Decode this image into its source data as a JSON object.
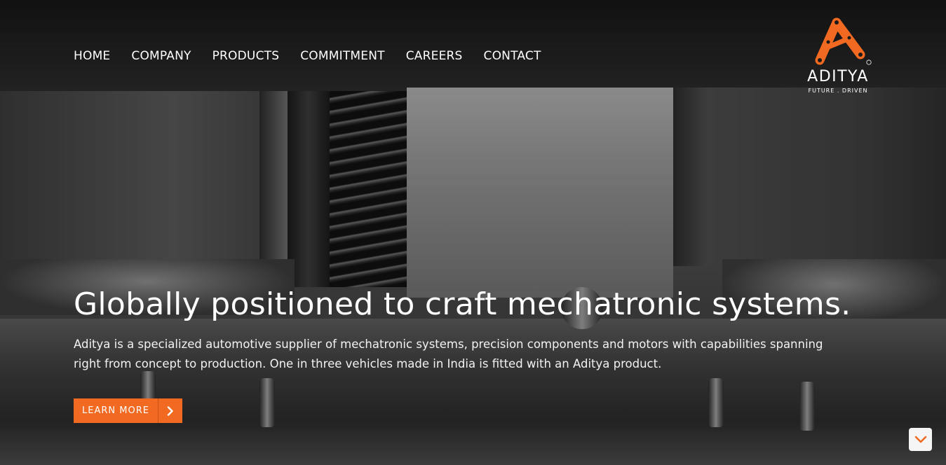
{
  "brand": {
    "name": "ADITYA",
    "tagline": "FUTURE . DRIVEN",
    "accent_color": "#f26a21",
    "registered_mark": "®"
  },
  "nav": {
    "items": [
      {
        "label": "HOME"
      },
      {
        "label": "COMPANY"
      },
      {
        "label": "PRODUCTS"
      },
      {
        "label": "COMMITMENT"
      },
      {
        "label": "CAREERS"
      },
      {
        "label": "CONTACT"
      }
    ]
  },
  "hero": {
    "title": "Globally positioned to craft mechatronic systems.",
    "description": "Aditya is a specialized automotive supplier of mechatronic systems, precision components and motors with capabilities spanning right from concept to production. One in three vehicles made in India is fitted with an Aditya product.",
    "cta_label": "LEARN MORE",
    "cta_icon": "chevron-right-icon"
  },
  "scroll_down": {
    "icon": "chevron-down-icon"
  }
}
